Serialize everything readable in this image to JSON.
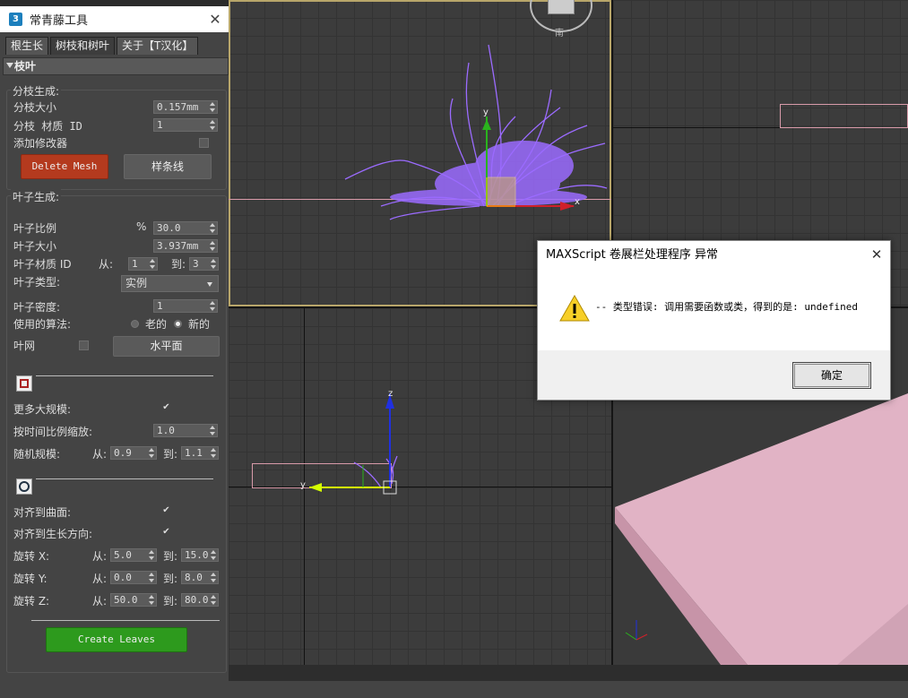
{
  "panel": {
    "title": "常青藤工具",
    "tabs": [
      "根生长",
      "树枝和树叶",
      "关于【T汉化】"
    ],
    "rollout_title": "枝叶",
    "branch_group": {
      "label": "分枝生成:",
      "branch_size_label": "分枝大小",
      "branch_size_value": "0.157mm",
      "branch_matid_label": "分枝 材质 ID",
      "branch_matid_value": "1",
      "add_modifier_label": "添加修改器",
      "delete_mesh_label": "Delete Mesh",
      "spline_label": "样条线"
    },
    "leaf_group": {
      "label": "叶子生成:",
      "leaf_ratio_label": "叶子比例",
      "leaf_ratio_unit": "%",
      "leaf_ratio_value": "30.0",
      "leaf_size_label": "叶子大小",
      "leaf_size_value": "3.937mm",
      "leaf_matid_label": "叶子材质 ID",
      "from_label": "从:",
      "to_label": "到:",
      "leaf_matid_from": "1",
      "leaf_matid_to": "3",
      "leaf_type_label": "叶子类型:",
      "leaf_type_value": "实例",
      "leaf_density_label": "叶子密度:",
      "leaf_density_value": "1",
      "algorithm_label": "使用的算法:",
      "algo_old": "老的",
      "algo_new": "新的",
      "leaf_mesh_label": "叶网",
      "plane_label": "水平面",
      "more_scale_label": "更多大规模:",
      "scale_time_label": "按时间比例缩放:",
      "scale_time_value": "1.0",
      "random_scale_label": "随机规模:",
      "random_scale_from": "0.9",
      "random_scale_to": "1.1",
      "align_surface_label": "对齐到曲面:",
      "align_growth_label": "对齐到生长方向:",
      "rot_x_label": "旋转 X:",
      "rot_x_from": "5.0",
      "rot_x_to": "15.0",
      "rot_y_label": "旋转 Y:",
      "rot_y_from": "0.0",
      "rot_y_to": "8.0",
      "rot_z_label": "旋转 Z:",
      "rot_z_from": "50.0",
      "rot_z_to": "80.0",
      "create_leaves_label": "Create Leaves"
    }
  },
  "viewport": {
    "compass_label": "南",
    "axis_x": "x",
    "axis_y": "y",
    "axis_z": "z"
  },
  "dialog": {
    "title": "MAXScript 卷展栏处理程序 异常",
    "message": "-- 类型错误: 调用需要函数或类，得到的是: undefined",
    "ok_label": "确定"
  },
  "colors": {
    "accent_red": "#b43a1e",
    "accent_green": "#2d9a1d",
    "ivy": "#9b6bff"
  }
}
